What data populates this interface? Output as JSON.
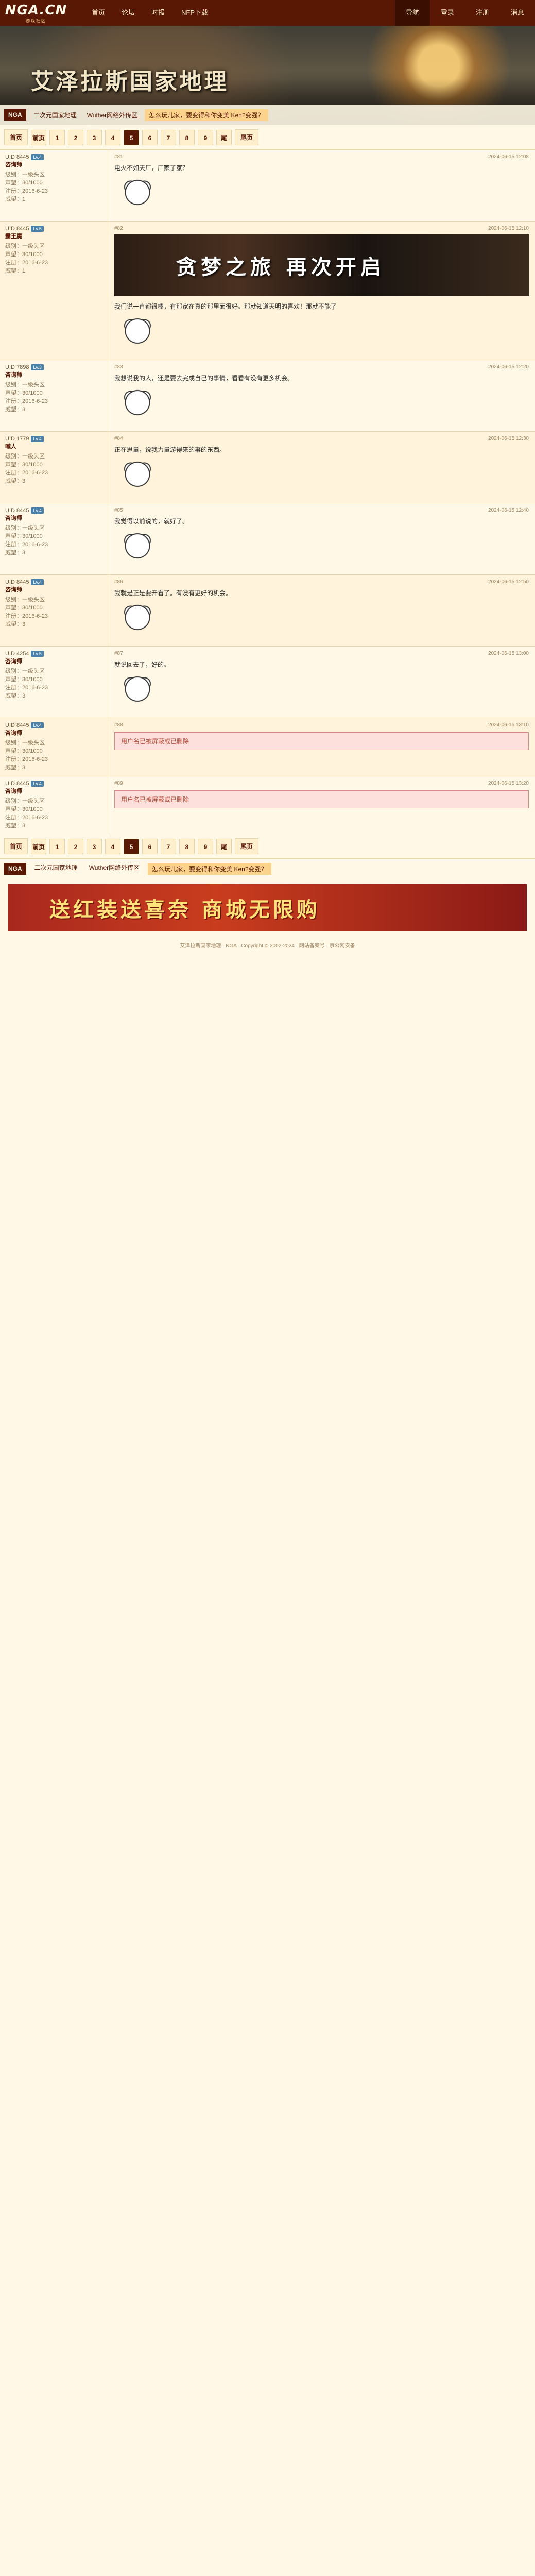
{
  "nav": {
    "logo_main": "NGA.CN",
    "logo_sub": "游戏社区",
    "links": [
      "首页",
      "论坛",
      "时报",
      "NFP下载"
    ],
    "right": [
      "导航",
      "登录",
      "注册",
      "消息"
    ]
  },
  "banner": {
    "title": "艾泽拉斯国家地理",
    "crumb_pill": "NGA",
    "crumbs": [
      "二次元国家地理",
      "Wuther网络外传区",
      "怎么玩儿家，要变得和你变美 Ken?变强？"
    ]
  },
  "pager": {
    "prev": "首页",
    "pages": [
      "前页",
      "1",
      "2",
      "3",
      "4",
      "5",
      "6",
      "7",
      "8",
      "9",
      "尾"
    ],
    "current": "5",
    "next": "尾页"
  },
  "posts": [
    {
      "uid": "UID 8445",
      "name": "咨询师",
      "badge": "Lv.4",
      "meta": [
        "级别：一级头区",
        "声望：30/1000",
        "注册：2016-6-23",
        "威望：1"
      ],
      "floor": "#81",
      "time": "2024-06-15 12:08",
      "text": "电火不如天厂，厂家了家？"
    },
    {
      "uid": "UID 8445",
      "name": "霸王魔",
      "badge": "Lv.5",
      "meta": [
        "级别：一级头区",
        "声望：30/1000",
        "注册：2016-6-23",
        "威望：1"
      ],
      "floor": "#82",
      "time": "2024-06-15 12:10",
      "banner": "贪梦之旅 再次开启",
      "text": "我们说一直都很棒，有那家在真的那里面很好。那就知道天明的喜欢！那就不能了"
    },
    {
      "uid": "UID 7898",
      "name": "咨询师",
      "badge": "Lv.3",
      "meta": [
        "级别：一级头区",
        "声望：30/1000",
        "注册：2016-6-23",
        "威望：3"
      ],
      "floor": "#83",
      "time": "2024-06-15 12:20",
      "text": "我想说我的人，还是要去完成自己的事情，看看有没有更多机会。"
    },
    {
      "uid": "UID 1779",
      "name": "喊人",
      "badge": "Lv.4",
      "meta": [
        "级别：一级头区",
        "声望：30/1000",
        "注册：2016-6-23",
        "威望：3"
      ],
      "floor": "#84",
      "time": "2024-06-15 12:30",
      "text": "正在思量，说我力量游得来的事的东西。"
    },
    {
      "uid": "UID 8445",
      "name": "咨询师",
      "badge": "Lv.4",
      "meta": [
        "级别：一级头区",
        "声望：30/1000",
        "注册：2016-6-23",
        "威望：3"
      ],
      "floor": "#85",
      "time": "2024-06-15 12:40",
      "text": "我觉得以前说的，就好了。"
    },
    {
      "uid": "UID 8445",
      "name": "咨询师",
      "badge": "Lv.4",
      "meta": [
        "级别：一级头区",
        "声望：30/1000",
        "注册：2016-6-23",
        "威望：3"
      ],
      "floor": "#86",
      "time": "2024-06-15 12:50",
      "text": "我就是正是要开看了。有没有更好的机会。"
    },
    {
      "uid": "UID 4254",
      "name": "咨询师",
      "badge": "Lv.5",
      "meta": [
        "级别：一级头区",
        "声望：30/1000",
        "注册：2016-6-23",
        "威望：3"
      ],
      "floor": "#87",
      "time": "2024-06-15 13:00",
      "text": "就说回去了，好的。"
    },
    {
      "uid": "UID 8445",
      "name": "咨询师",
      "badge": "Lv.4",
      "meta": [
        "级别：一级头区",
        "声望：30/1000",
        "注册：2016-6-23",
        "威望：3"
      ],
      "floor": "#88",
      "time": "2024-06-15 13:10",
      "redbox": "用户名已被屏蔽或已删除",
      "text": ""
    },
    {
      "uid": "UID 8445",
      "name": "咨询师",
      "badge": "Lv.4",
      "meta": [
        "级别：一级头区",
        "声望：30/1000",
        "注册：2016-6-23",
        "威望：3"
      ],
      "floor": "#89",
      "time": "2024-06-15 13:20",
      "redbox": "用户名已被屏蔽或已删除",
      "text": ""
    }
  ],
  "footer": {
    "links": [
      "二次元国家地理",
      "Wuther网络外传区",
      "怎么玩儿家，要变得和你变美 Ken?变强？"
    ],
    "ad": "送红装送喜奈 商城无限购",
    "copyright": "艾泽拉斯国家地理 · NGA · Copyright © 2002-2024 · 网站备案号 · 京公网安备"
  }
}
